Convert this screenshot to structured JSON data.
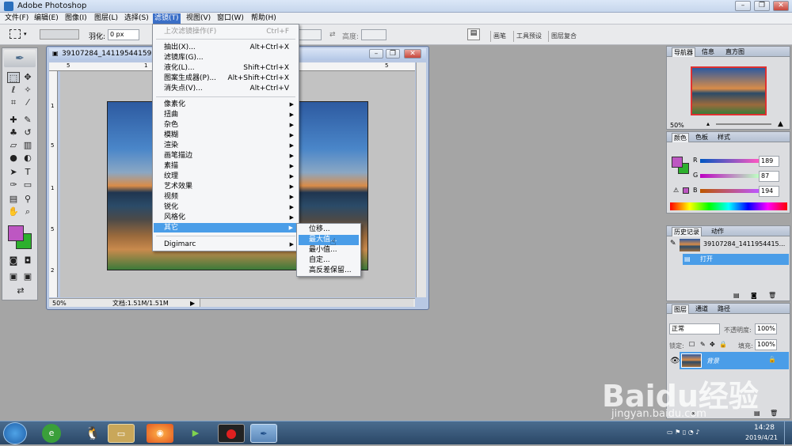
{
  "window": {
    "title": "Adobe Photoshop"
  },
  "menubar": {
    "items": [
      "文件(F)",
      "编辑(E)",
      "图像(I)",
      "图层(L)",
      "选择(S)",
      "滤镜(T)",
      "视图(V)",
      "窗口(W)",
      "帮助(H)"
    ]
  },
  "options": {
    "feather_label": "羽化:",
    "feather_value": "0 px",
    "height_label": "高度:",
    "tabs": [
      "画笔",
      "工具预设",
      "图层复合"
    ]
  },
  "document": {
    "title": "39107284_141195441592…",
    "zoom": "50%",
    "status": "文档:1.51M/1.51M",
    "ruler_top": [
      "5",
      "1",
      "5"
    ],
    "ruler_left": [
      "1",
      "5",
      "1",
      "5",
      "2"
    ]
  },
  "filter_menu": {
    "top": {
      "label": "上次滤镜操作(F)",
      "shortcut": "Ctrl+F"
    },
    "group1": [
      {
        "label": "抽出(X)...",
        "shortcut": "Alt+Ctrl+X"
      },
      {
        "label": "滤镜库(G)...",
        "shortcut": ""
      },
      {
        "label": "液化(L)...",
        "shortcut": "Shift+Ctrl+X"
      },
      {
        "label": "图案生成器(P)...",
        "shortcut": "Alt+Shift+Ctrl+X"
      },
      {
        "label": "消失点(V)...",
        "shortcut": "Alt+Ctrl+V"
      }
    ],
    "group2": [
      "像素化",
      "扭曲",
      "杂色",
      "模糊",
      "渲染",
      "画笔描边",
      "素描",
      "纹理",
      "艺术效果",
      "视频",
      "锐化",
      "风格化",
      "其它"
    ],
    "group3": [
      "Digimarc"
    ]
  },
  "submenu": {
    "items": [
      "位移...",
      "最大值...",
      "最小值...",
      "自定...",
      "高反差保留..."
    ],
    "highlighted": "最大值..."
  },
  "navigator": {
    "tabs": [
      "导航器",
      "信息",
      "直方图"
    ],
    "zoom": "50%"
  },
  "color_panel": {
    "tabs": [
      "颜色",
      "色板",
      "样式"
    ],
    "r_label": "R",
    "r": "189",
    "g_label": "G",
    "g": "87",
    "b_label": "B",
    "b": "194",
    "foreground": "#bd57c2",
    "background": "#2db02d"
  },
  "history_panel": {
    "tabs": [
      "历史记录",
      "动作"
    ],
    "snapshot": "39107284_1411954415...",
    "step": "打开"
  },
  "layers_panel": {
    "tabs": [
      "图层",
      "通道",
      "路径"
    ],
    "blend": "正常",
    "opacity_label": "不透明度:",
    "opacity": "100%",
    "lock_label": "锁定:",
    "fill_label": "填充:",
    "fill": "100%",
    "layer_name": "背景"
  },
  "taskbar": {
    "time": "14:28",
    "date": "2019/4/21"
  },
  "watermark": {
    "brand": "Baidu经验",
    "url": "jingyan.baidu.com"
  },
  "colors": {
    "accent": "#3b6fc7",
    "selection": "#4a9de8"
  }
}
